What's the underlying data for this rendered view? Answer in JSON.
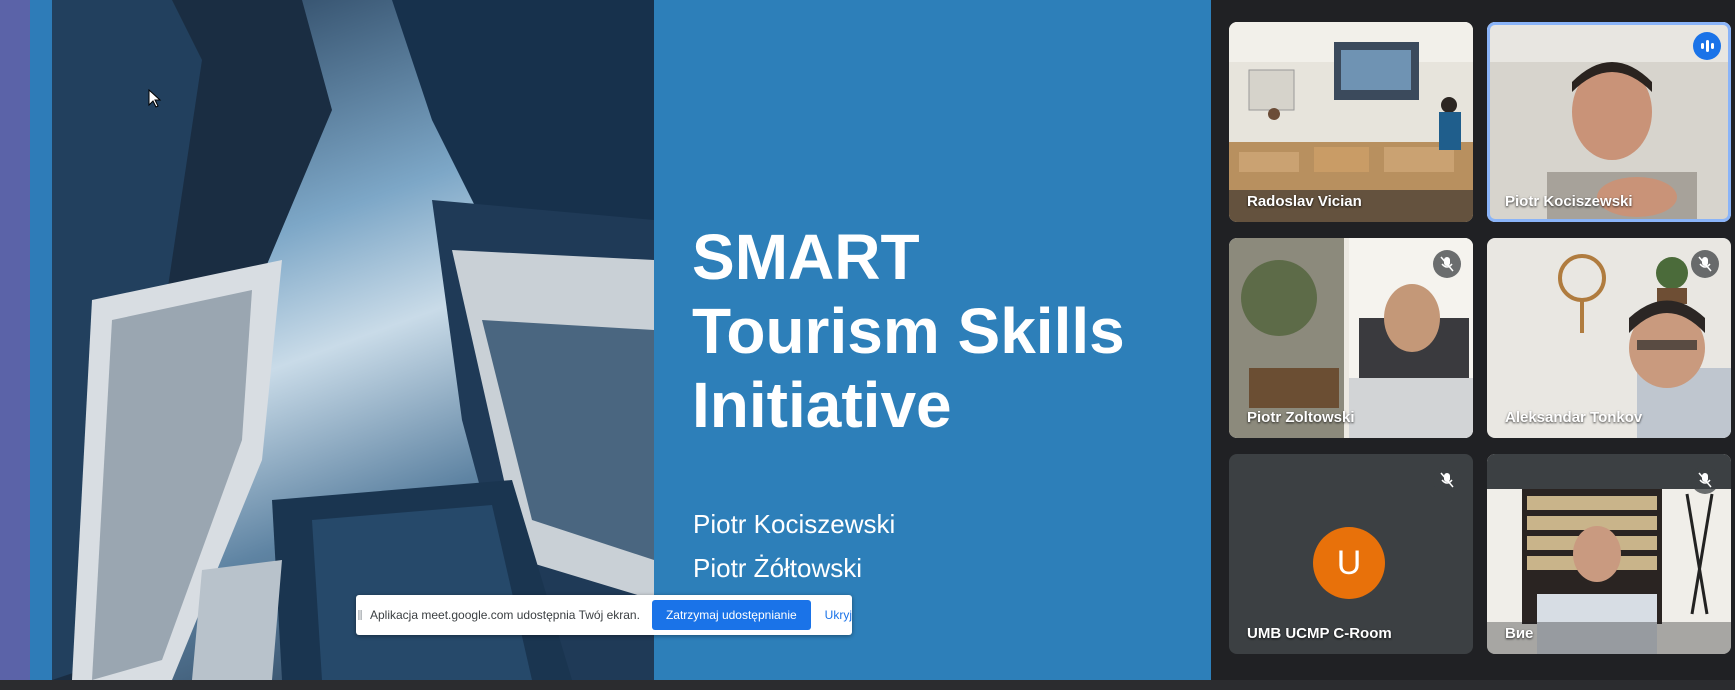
{
  "slide": {
    "title_lines": [
      "SMART",
      "Tourism Skills",
      "Initiative"
    ],
    "authors": [
      "Piotr Kociszewski",
      "Piotr Żółtowski"
    ]
  },
  "share_banner": {
    "message": "Aplikacja meet.google.com udostępnia Twój ekran.",
    "stop_label": "Zatrzymaj udostępnianie",
    "hide_label": "Ukryj"
  },
  "participants": [
    {
      "name": "Radoslav Vician",
      "muted": false
    },
    {
      "name": "Piotr Kociszewski",
      "speaking": true
    },
    {
      "name": "Piotr Zoltowski",
      "muted": true
    },
    {
      "name": "Aleksandar Tonkov",
      "muted": true
    },
    {
      "name": "UMB UCMP C-Room",
      "muted": true,
      "avatar_letter": "U"
    },
    {
      "name": "Вие",
      "muted": true
    }
  ],
  "colors": {
    "accent": "#1a73e8",
    "slide_bg": "#2d7fb9",
    "avatar_orange": "#e8710a"
  }
}
